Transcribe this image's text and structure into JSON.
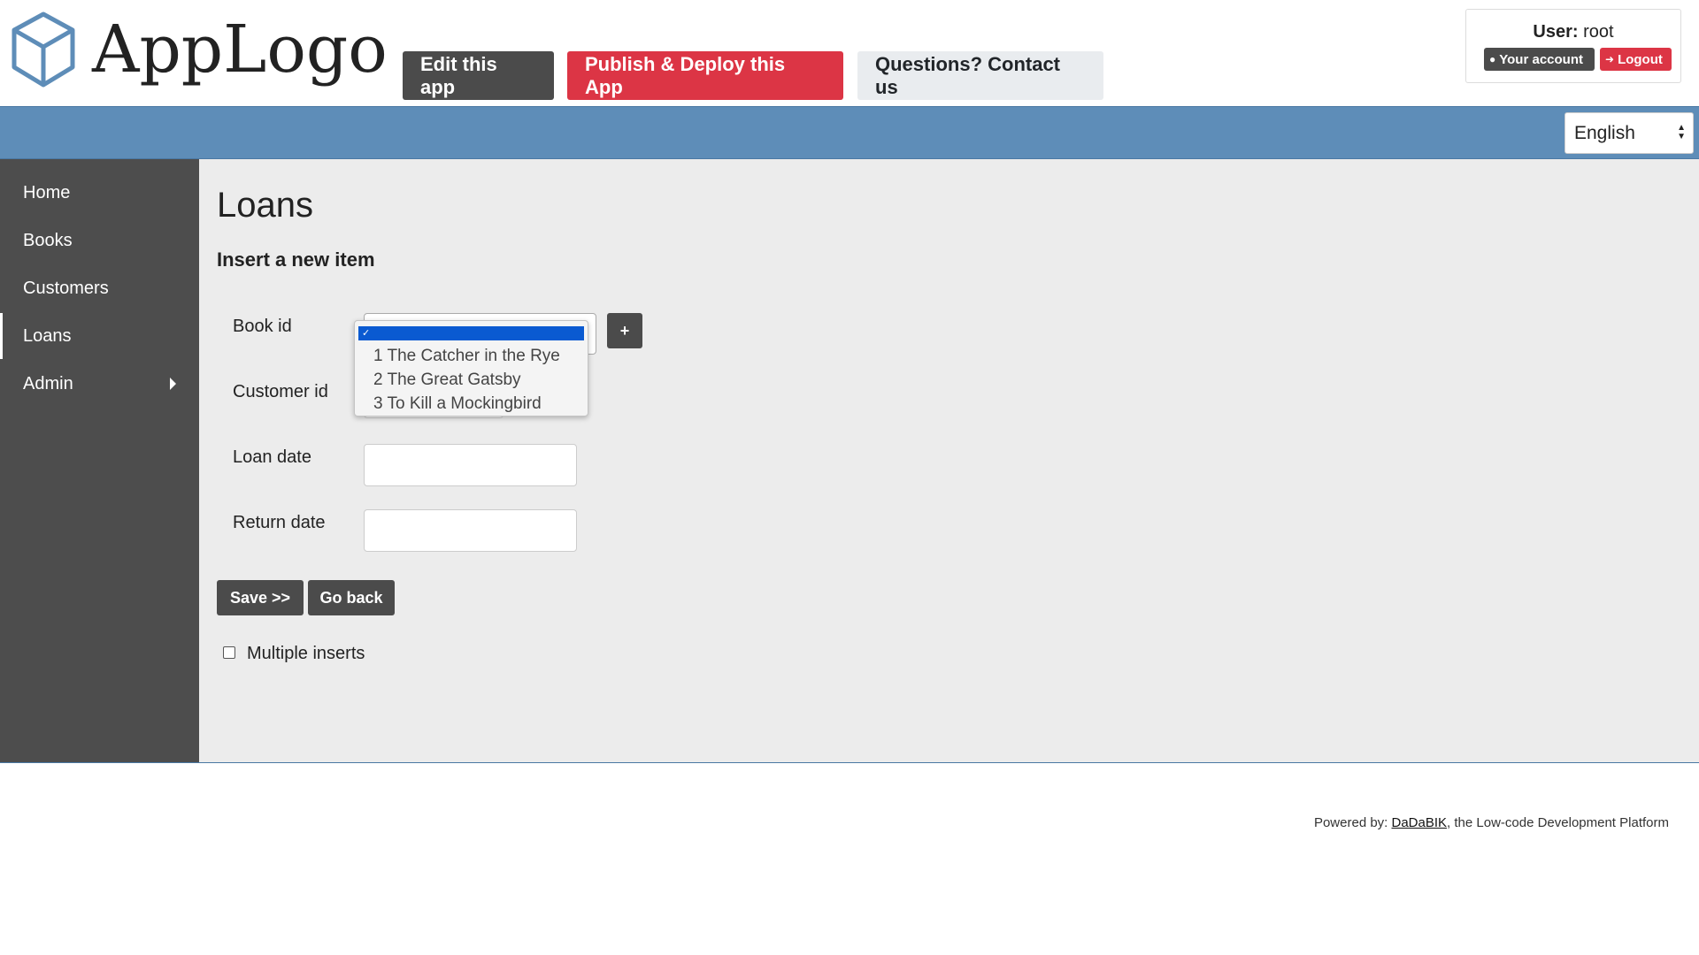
{
  "header": {
    "logo_text": "AppLogo",
    "edit_button": "Edit this app",
    "publish_button": "Publish & Deploy this App",
    "contact_button": "Questions? Contact us",
    "user_label": "User:",
    "user_name": "root",
    "account_button": "Your account",
    "logout_button": "Logout"
  },
  "language": {
    "selected": "English"
  },
  "sidebar": {
    "items": [
      {
        "label": "Home"
      },
      {
        "label": "Books"
      },
      {
        "label": "Customers"
      },
      {
        "label": "Loans",
        "active": true
      },
      {
        "label": "Admin",
        "has_submenu": true
      }
    ]
  },
  "main": {
    "title": "Loans",
    "subtitle": "Insert a new item",
    "fields": {
      "book_id": "Book id",
      "customer_id": "Customer id",
      "loan_date": "Loan date",
      "return_date": "Return date"
    },
    "plus_button": "+",
    "save_button": "Save >>",
    "back_button": "Go back",
    "multiple_inserts": "Multiple inserts"
  },
  "dropdown": {
    "selected_mark": "✓",
    "options": [
      "1 The Catcher in the Rye",
      "2 The Great Gatsby",
      "3 To Kill a Mockingbird"
    ]
  },
  "footer": {
    "prefix": "Powered by: ",
    "link": "DaDaBIK",
    "suffix": ", the Low-code Development Platform"
  },
  "colors": {
    "header_bar": "#5e8db8",
    "sidebar": "#4d4d4d",
    "primary_dark": "#4b4b4b",
    "danger": "#dc3545",
    "selection": "#0a5ad1"
  }
}
